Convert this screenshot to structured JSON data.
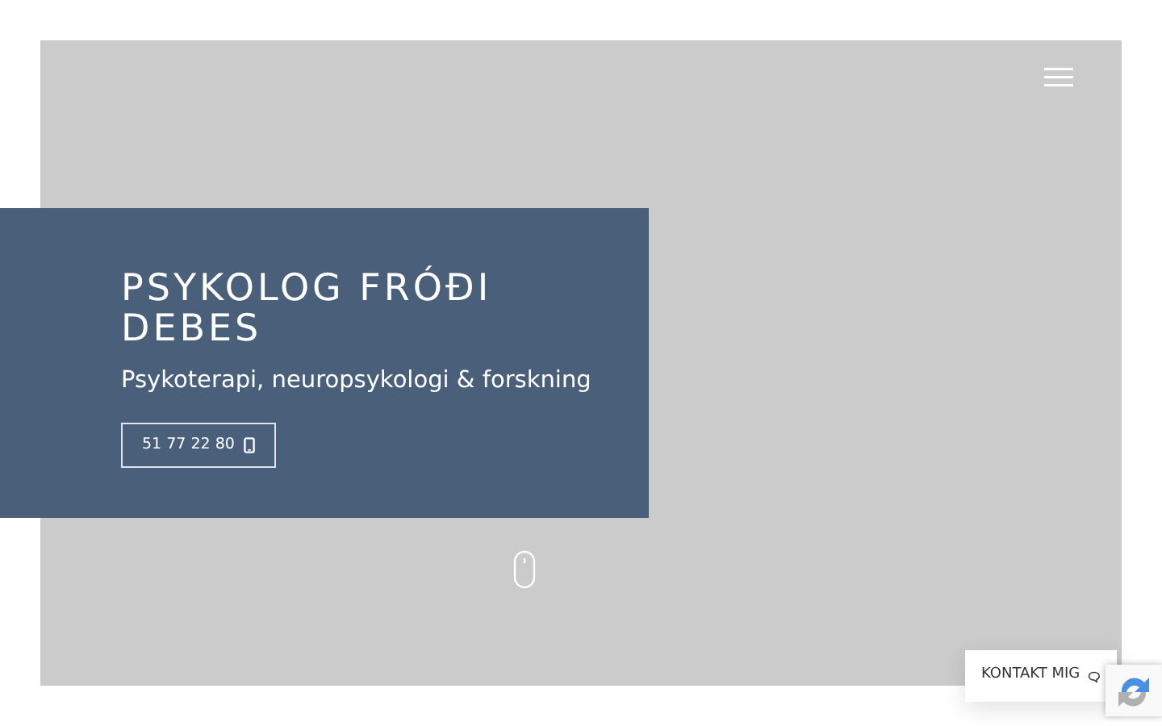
{
  "hero": {
    "title": "PSYKOLOG FRÓÐI DEBES",
    "subtitle": "Psykoterapi, neuropsykologi & forskning",
    "phone_button": "51 77 22 80"
  },
  "contact_button": "KONTAKT MIG"
}
